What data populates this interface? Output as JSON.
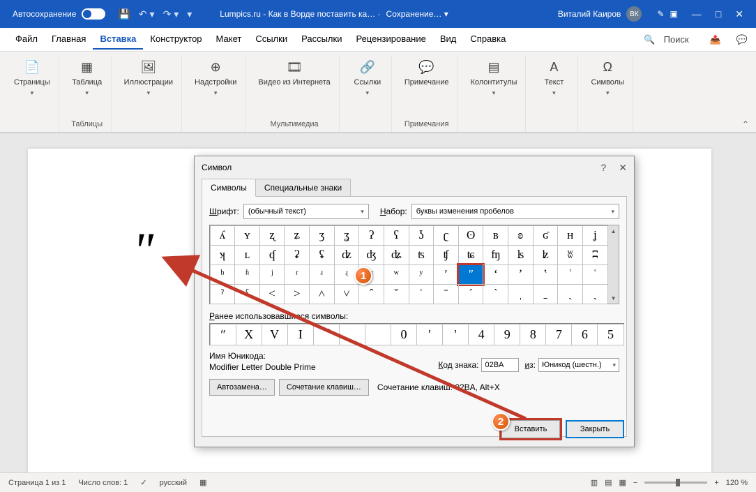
{
  "titlebar": {
    "autosave": "Автосохранение",
    "doc_title": "Lumpics.ru - Как в Ворде поставить ка… ·",
    "saving": "Сохранение… ▾",
    "user": "Виталий Каиров",
    "avatar": "ВК"
  },
  "menu": {
    "tabs": [
      "Файл",
      "Главная",
      "Вставка",
      "Конструктор",
      "Макет",
      "Ссылки",
      "Рассылки",
      "Рецензирование",
      "Вид",
      "Справка"
    ],
    "active_index": 2,
    "search": "Поиск"
  },
  "ribbon": {
    "groups": [
      {
        "label": "",
        "items": [
          {
            "icon": "📄",
            "text": "Страницы",
            "drop": true
          }
        ]
      },
      {
        "label": "Таблицы",
        "items": [
          {
            "icon": "▦",
            "text": "Таблица",
            "drop": true
          }
        ]
      },
      {
        "label": "",
        "items": [
          {
            "icon": "🖼",
            "text": "Иллюстрации",
            "drop": true
          }
        ]
      },
      {
        "label": "",
        "items": [
          {
            "icon": "⊕",
            "text": "Надстройки",
            "drop": true
          }
        ]
      },
      {
        "label": "Мультимедиа",
        "items": [
          {
            "icon": "🎞",
            "text": "Видео из Интернета"
          }
        ]
      },
      {
        "label": "",
        "items": [
          {
            "icon": "🔗",
            "text": "Ссылки",
            "drop": true
          }
        ]
      },
      {
        "label": "Примечания",
        "items": [
          {
            "icon": "💬",
            "text": "Примечание"
          }
        ]
      },
      {
        "label": "",
        "items": [
          {
            "icon": "▤",
            "text": "Колонтитулы",
            "drop": true
          }
        ]
      },
      {
        "label": "",
        "items": [
          {
            "icon": "A",
            "text": "Текст",
            "drop": true
          }
        ]
      },
      {
        "label": "",
        "items": [
          {
            "icon": "Ω",
            "text": "Символы",
            "drop": true
          }
        ]
      }
    ]
  },
  "document": {
    "char": "ʺ"
  },
  "statusbar": {
    "page": "Страница 1 из 1",
    "words": "Число слов: 1",
    "lang": "русский",
    "zoom": "120 %"
  },
  "dialog": {
    "title": "Символ",
    "tabs": [
      "Символы",
      "Специальные знаки"
    ],
    "font_label": "Шрифт:",
    "font_value": "(обычный текст)",
    "subset_label": "Набор:",
    "subset_value": "буквы изменения пробелов",
    "grid": [
      [
        "ʎ",
        "ʏ",
        "ʐ",
        "ʑ",
        "ʒ",
        "ʓ",
        "ʔ",
        "ʕ",
        "ʖ",
        "ʗ",
        "ʘ",
        "ʙ",
        "ʚ",
        "ʛ",
        "ʜ",
        "ʝ"
      ],
      [
        "ʞ",
        "ʟ",
        "ʠ",
        "ʡ",
        "ʢ",
        "ʣ",
        "ʤ",
        "ʥ",
        "ʦ",
        "ʧ",
        "ʨ",
        "ʩ",
        "ʪ",
        "ʫ",
        "ʬ",
        "ʭ"
      ],
      [
        "ʰ",
        "ʱ",
        "ʲ",
        "ʳ",
        "ʴ",
        "ʵ",
        "ʶ",
        "ʷ",
        "ʸ",
        "ʹ",
        "ʺ",
        "ʻ",
        "ʼ",
        "ʽ",
        "ʾ",
        "ʿ"
      ],
      [
        "ˀ",
        "ˁ",
        "˂",
        "˃",
        "˄",
        "˅",
        "ˆ",
        "ˇ",
        "ˈ",
        "ˉ",
        "ˊ",
        "ˋ",
        "ˌ",
        "ˍ",
        "ˎ",
        "ˏ"
      ]
    ],
    "selected": {
      "row": 2,
      "col": 10
    },
    "recent_label": "Ранее использовавшиеся символы:",
    "recent": [
      "ʺ",
      "Х",
      "V",
      "I",
      "¯",
      "",
      "",
      "0",
      "′",
      "'",
      "4",
      "9",
      "8",
      "7",
      "6",
      "5"
    ],
    "recent_last": "☑",
    "unicode_label": "Имя Юникода:",
    "unicode_name": "Modifier Letter Double Prime",
    "code_label": "Код знака:",
    "code_value": "02BA",
    "from_label": "из:",
    "from_value": "Юникод (шестн.)",
    "autocorrect_btn": "Автозамена…",
    "shortcut_btn": "Сочетание клавиш…",
    "shortcut_label": "Сочетание клавиш: 02BA, Alt+X",
    "insert_btn": "Вставить",
    "close_btn": "Закрыть"
  },
  "markers": {
    "one": "1",
    "two": "2"
  }
}
